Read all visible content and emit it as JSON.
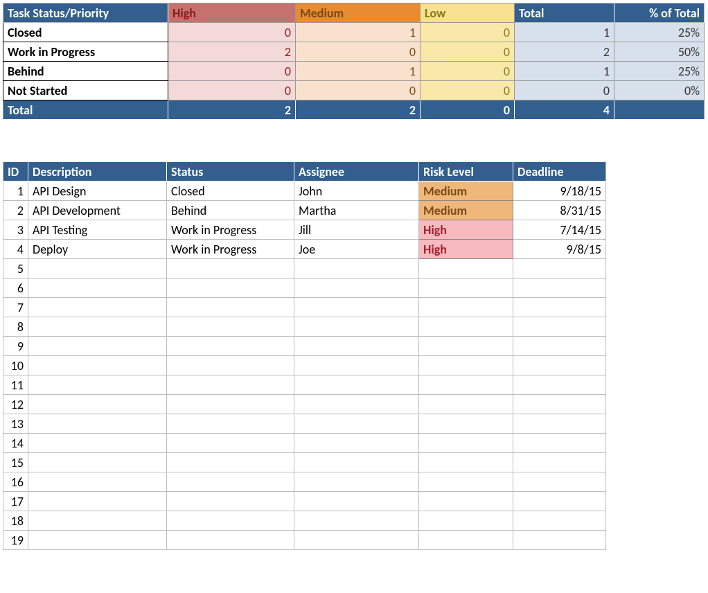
{
  "summary": {
    "headers": {
      "col1": "Task Status/Priority",
      "high": "High",
      "medium": "Medium",
      "low": "Low",
      "total": "Total",
      "pct": "% of Total"
    },
    "rows": [
      {
        "status": "Closed",
        "high": "0",
        "medium": "1",
        "low": "0",
        "total": "1",
        "pct": "25%"
      },
      {
        "status": "Work in Progress",
        "high": "2",
        "medium": "0",
        "low": "0",
        "total": "2",
        "pct": "50%"
      },
      {
        "status": "Behind",
        "high": "0",
        "medium": "1",
        "low": "0",
        "total": "1",
        "pct": "25%"
      },
      {
        "status": "Not Started",
        "high": "0",
        "medium": "0",
        "low": "0",
        "total": "0",
        "pct": "0%"
      }
    ],
    "totals": {
      "label": "Total",
      "high": "2",
      "medium": "2",
      "low": "0",
      "total": "4",
      "pct": ""
    }
  },
  "tasks": {
    "headers": {
      "id": "ID",
      "description": "Description",
      "status": "Status",
      "assignee": "Assignee",
      "risk": "Risk Level",
      "deadline": "Deadline"
    },
    "rows": [
      {
        "id": "1",
        "desc": "API Design",
        "status": "Closed",
        "assignee": "John",
        "risk": "Medium",
        "risk_class": "risk-med",
        "deadline": "9/18/15"
      },
      {
        "id": "2",
        "desc": "API Development",
        "status": "Behind",
        "assignee": "Martha",
        "risk": "Medium",
        "risk_class": "risk-med",
        "deadline": "8/31/15"
      },
      {
        "id": "3",
        "desc": "API Testing",
        "status": "Work in Progress",
        "assignee": "Jill",
        "risk": "High",
        "risk_class": "risk-high",
        "deadline": "7/14/15"
      },
      {
        "id": "4",
        "desc": "Deploy",
        "status": "Work in Progress",
        "assignee": "Joe",
        "risk": "High",
        "risk_class": "risk-high",
        "deadline": "9/8/15"
      }
    ],
    "empty_ids": [
      "5",
      "6",
      "7",
      "8",
      "9",
      "10",
      "11",
      "12",
      "13",
      "14",
      "15",
      "16",
      "17",
      "18",
      "19"
    ]
  }
}
